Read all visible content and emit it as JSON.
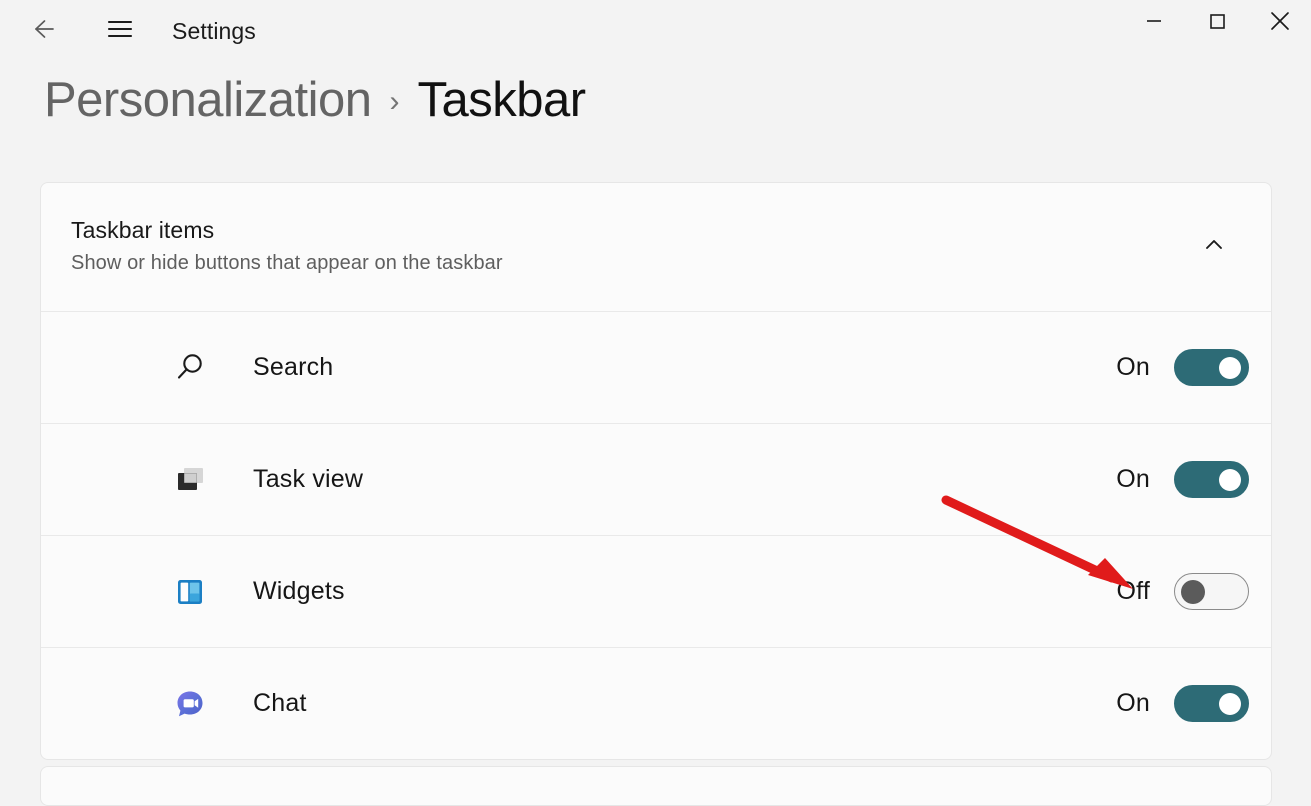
{
  "window": {
    "title": "Settings",
    "back_icon": "back-arrow-icon",
    "menu_icon": "hamburger-menu-icon",
    "controls": [
      {
        "name": "minimize",
        "icon": "minimize-icon",
        "glyph": "—"
      },
      {
        "name": "maximize",
        "icon": "maximize-icon",
        "glyph": "□"
      },
      {
        "name": "close",
        "icon": "close-icon",
        "glyph": "✕"
      }
    ]
  },
  "breadcrumb": {
    "parent": "Personalization",
    "separator": "›",
    "current": "Taskbar"
  },
  "card": {
    "title": "Taskbar items",
    "subtitle": "Show or hide buttons that appear on the taskbar",
    "collapse_icon": "chevron-up-icon",
    "expanded": true,
    "rows": [
      {
        "icon": "search-icon",
        "label": "Search",
        "state": "On",
        "on": true
      },
      {
        "icon": "task-view-icon",
        "label": "Task view",
        "state": "On",
        "on": true
      },
      {
        "icon": "widgets-icon",
        "label": "Widgets",
        "state": "Off",
        "on": false
      },
      {
        "icon": "chat-icon",
        "label": "Chat",
        "state": "On",
        "on": true
      }
    ]
  },
  "annotation": {
    "type": "red-arrow",
    "color": "#e01b1b",
    "points_at": "widgets-toggle"
  },
  "colors": {
    "page_background": "#f3f3f3",
    "card_background": "#fbfbfb",
    "toggle_on": "#2d6b76",
    "toggle_off_knob": "#5b5b5b",
    "breadcrumb_parent": "#646464",
    "annotation_red": "#e01b1b"
  }
}
